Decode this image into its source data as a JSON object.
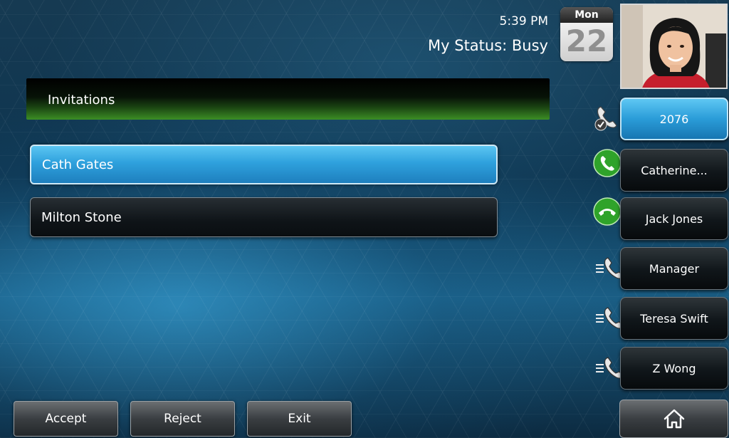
{
  "status": {
    "time": "5:39 PM",
    "my_status": "My Status: Busy",
    "calendar_day": "Mon",
    "calendar_date": "22"
  },
  "header": {
    "title": "Invitations"
  },
  "invitations": [
    {
      "name": "Cath Gates",
      "selected": true
    },
    {
      "name": "Milton Stone",
      "selected": false
    }
  ],
  "line_keys": [
    {
      "label": "2076",
      "icon": "line-registered-icon",
      "active": true
    },
    {
      "label": "Catherine...",
      "icon": "incoming-call-icon",
      "active": false
    },
    {
      "label": "Jack Jones",
      "icon": "active-call-icon",
      "active": false
    },
    {
      "label": "Manager",
      "icon": "idle-line-icon",
      "active": false
    },
    {
      "label": "Teresa Swift",
      "icon": "idle-line-icon",
      "active": false
    },
    {
      "label": "Z Wong",
      "icon": "idle-line-icon",
      "active": false
    }
  ],
  "soft_keys": {
    "accept": "Accept",
    "reject": "Reject",
    "exit": "Exit"
  },
  "colors": {
    "selected_row": "#2ea1dd",
    "header_green": "#3c8e25",
    "call_green": "#2fa32a"
  }
}
